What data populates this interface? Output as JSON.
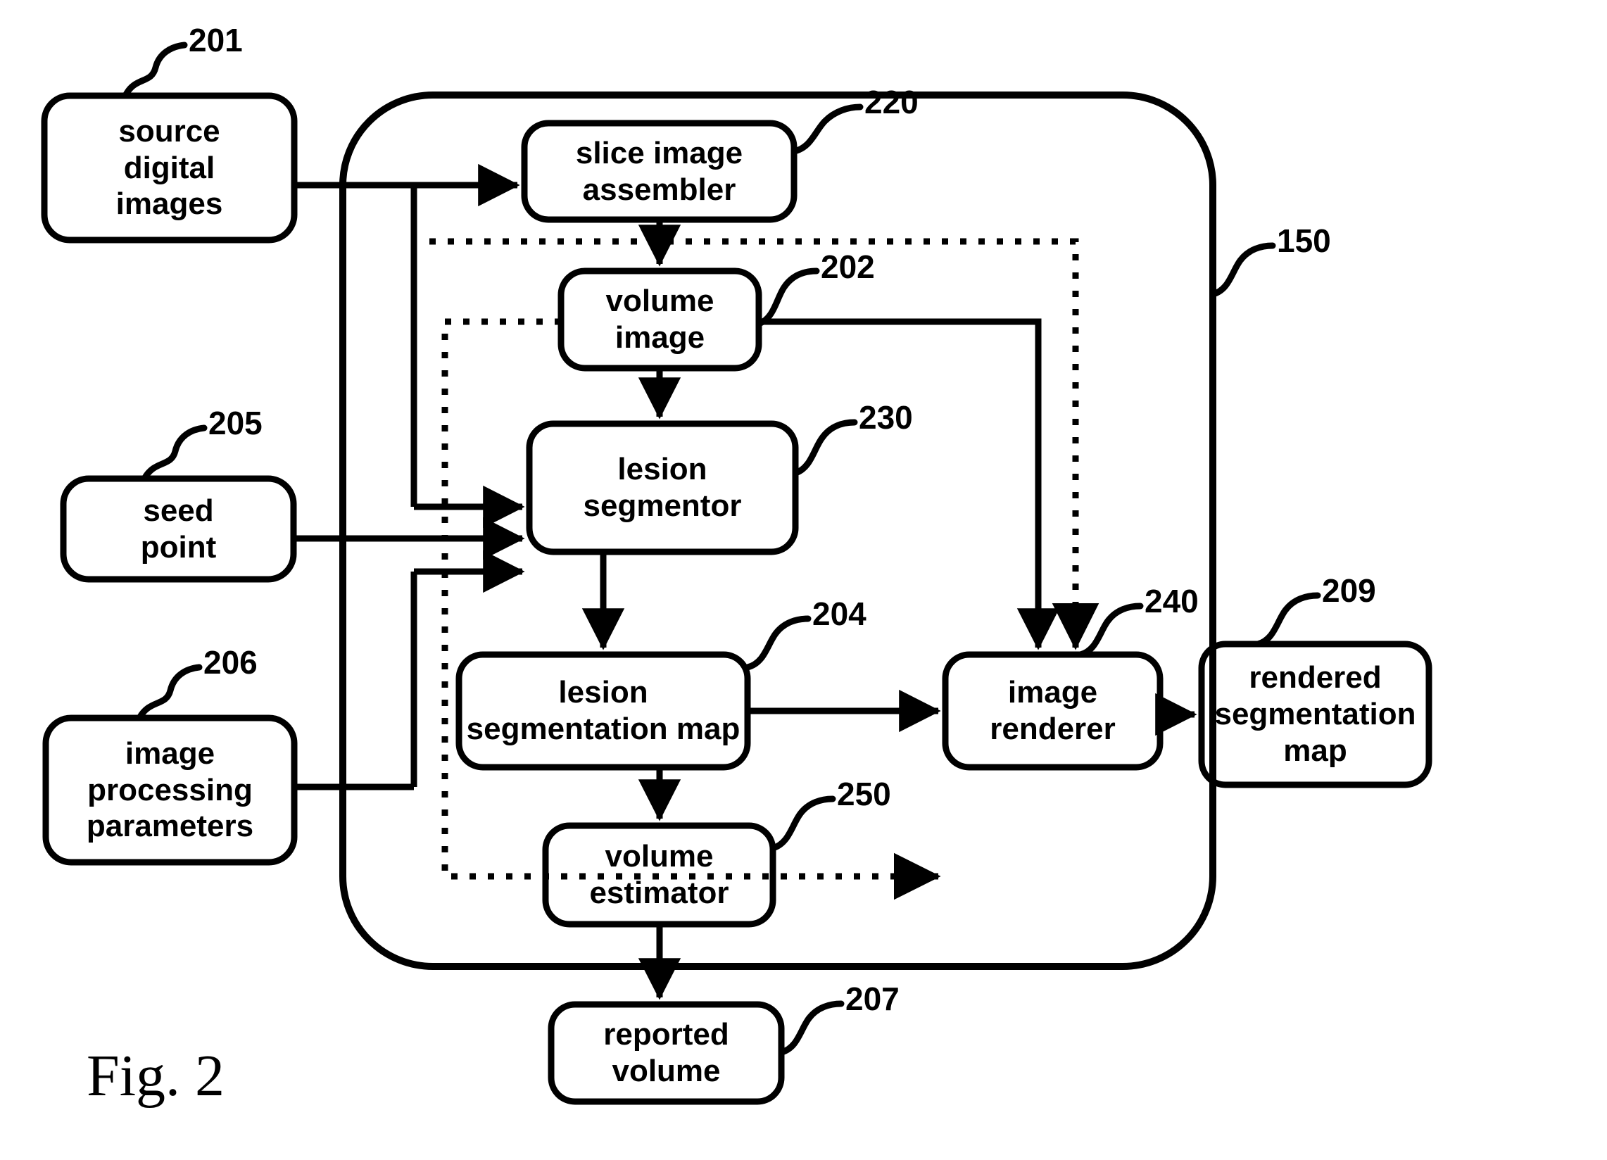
{
  "figure": {
    "caption": "Fig. 2",
    "container_ref": "150"
  },
  "nodes": [
    {
      "id": "source_digital_images",
      "ref": "201",
      "label": "source\ndigital\nimages"
    },
    {
      "id": "slice_image_assembler",
      "ref": "220",
      "label": "slice image\nassembler"
    },
    {
      "id": "volume_image",
      "ref": "202",
      "label": "volume\nimage"
    },
    {
      "id": "seed_point",
      "ref": "205",
      "label": "seed\npoint"
    },
    {
      "id": "lesion_segmentor",
      "ref": "230",
      "label": "lesion\nsegmentor"
    },
    {
      "id": "image_processing_parameters",
      "ref": "206",
      "label": "image\nprocessing\nparameters"
    },
    {
      "id": "lesion_segmentation_map",
      "ref": "204",
      "label": "lesion\nsegmentation map"
    },
    {
      "id": "image_renderer",
      "ref": "240",
      "label": "image\nrenderer"
    },
    {
      "id": "rendered_segmentation_map",
      "ref": "209",
      "label": "rendered\nsegmentation\nmap"
    },
    {
      "id": "volume_estimator",
      "ref": "250",
      "label": "volume\nestimator"
    },
    {
      "id": "reported_volume",
      "ref": "207",
      "label": "reported\nvolume"
    }
  ],
  "chart_data": {
    "type": "diagram",
    "title": "Fig. 2",
    "diagram_kind": "block flow diagram",
    "container": {
      "ref": "150",
      "contains": [
        "220",
        "202",
        "230",
        "204",
        "240",
        "250"
      ]
    },
    "blocks": [
      {
        "ref": "201",
        "text": "source digital images",
        "kind": "data"
      },
      {
        "ref": "220",
        "text": "slice image assembler",
        "kind": "process"
      },
      {
        "ref": "202",
        "text": "volume image",
        "kind": "data"
      },
      {
        "ref": "205",
        "text": "seed point",
        "kind": "data"
      },
      {
        "ref": "230",
        "text": "lesion segmentor",
        "kind": "process"
      },
      {
        "ref": "206",
        "text": "image processing parameters",
        "kind": "data"
      },
      {
        "ref": "204",
        "text": "lesion segmentation map",
        "kind": "data"
      },
      {
        "ref": "240",
        "text": "image renderer",
        "kind": "process"
      },
      {
        "ref": "209",
        "text": "rendered segmentation map",
        "kind": "data"
      },
      {
        "ref": "250",
        "text": "volume estimator",
        "kind": "process"
      },
      {
        "ref": "207",
        "text": "reported volume",
        "kind": "data"
      }
    ],
    "edges": [
      {
        "from": "201",
        "to": "220",
        "style": "solid"
      },
      {
        "from": "201",
        "to": "230",
        "style": "solid"
      },
      {
        "from": "220",
        "to": "202",
        "style": "solid"
      },
      {
        "from": "202",
        "to": "230",
        "style": "solid"
      },
      {
        "from": "202",
        "to": "240",
        "style": "solid"
      },
      {
        "from": "202",
        "to": "250",
        "style": "dotted"
      },
      {
        "from": "205",
        "to": "230",
        "style": "solid"
      },
      {
        "from": "206",
        "to": "230",
        "style": "solid"
      },
      {
        "from": "230",
        "to": "204",
        "style": "solid"
      },
      {
        "from": "204",
        "to": "240",
        "style": "solid"
      },
      {
        "from": "204",
        "to": "250",
        "style": "solid"
      },
      {
        "from": "220",
        "to": "240",
        "style": "dotted"
      },
      {
        "from": "240",
        "to": "209",
        "style": "solid"
      },
      {
        "from": "250",
        "to": "207",
        "style": "solid"
      }
    ]
  }
}
